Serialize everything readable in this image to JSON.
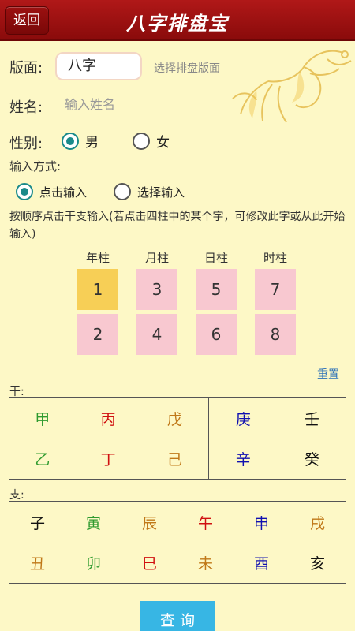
{
  "header": {
    "back_label": "返回",
    "title": "八字排盘宝",
    "bg_color": "#9e1212"
  },
  "form": {
    "layout_label": "版面:",
    "layout_value": "八字",
    "layout_hint": "选择排盘版面",
    "name_label": "姓名:",
    "name_placeholder": "输入姓名",
    "gender_label": "性别:",
    "gender_options": [
      "男",
      "女"
    ],
    "gender_selected": "男",
    "method_label": "输入方式:",
    "method_options": [
      "点击输入",
      "选择输入"
    ],
    "method_selected": "点击输入",
    "instruction": "按顺序点击干支输入(若点击四柱中的某个字，可修改此字或从此开始输入)"
  },
  "pillars": {
    "headers": [
      "年柱",
      "月柱",
      "日柱",
      "时柱"
    ],
    "top_row": [
      "1",
      "3",
      "5",
      "7"
    ],
    "bottom_row": [
      "2",
      "4",
      "6",
      "8"
    ],
    "active_cell": "1",
    "reset_label": "重置"
  },
  "stems": {
    "label": "干:",
    "rows": [
      [
        {
          "t": "甲",
          "c": "#2e9a2e"
        },
        {
          "t": "丙",
          "c": "#d01010"
        },
        {
          "t": "戊",
          "c": "#c07818"
        },
        {
          "t": "庚",
          "c": "#1010b0"
        },
        {
          "t": "壬",
          "c": "#111111"
        }
      ],
      [
        {
          "t": "乙",
          "c": "#2e9a2e"
        },
        {
          "t": "丁",
          "c": "#d01010"
        },
        {
          "t": "己",
          "c": "#c07818"
        },
        {
          "t": "辛",
          "c": "#1010b0"
        },
        {
          "t": "癸",
          "c": "#111111"
        }
      ]
    ]
  },
  "branches": {
    "label": "支:",
    "rows": [
      [
        {
          "t": "子",
          "c": "#111111"
        },
        {
          "t": "寅",
          "c": "#2e9a2e"
        },
        {
          "t": "辰",
          "c": "#c07818"
        },
        {
          "t": "午",
          "c": "#d01010"
        },
        {
          "t": "申",
          "c": "#1010b0"
        },
        {
          "t": "戌",
          "c": "#c07818"
        }
      ],
      [
        {
          "t": "丑",
          "c": "#c07818"
        },
        {
          "t": "卯",
          "c": "#2e9a2e"
        },
        {
          "t": "巳",
          "c": "#d01010"
        },
        {
          "t": "未",
          "c": "#c07818"
        },
        {
          "t": "酉",
          "c": "#1010b0"
        },
        {
          "t": "亥",
          "c": "#111111"
        }
      ]
    ]
  },
  "actions": {
    "query_label": "查 询",
    "query_color": "#37b6e4"
  }
}
